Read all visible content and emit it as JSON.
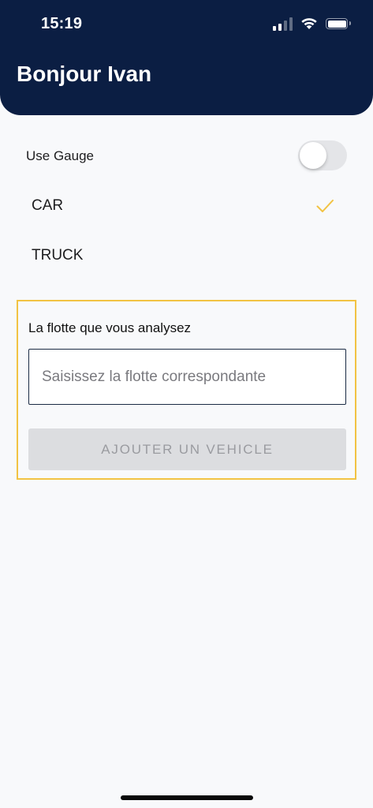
{
  "status_bar": {
    "time": "15:19",
    "icons": [
      "cellular-signal-icon",
      "wifi-icon",
      "battery-icon"
    ]
  },
  "header": {
    "title": "Bonjour Ivan",
    "background": "#0b1e43"
  },
  "settings": {
    "gauge_label": "Use Gauge",
    "gauge_enabled": false,
    "vehicle_types": [
      {
        "label": "CAR",
        "selected": true
      },
      {
        "label": "TRUCK",
        "selected": false
      }
    ],
    "check_color": "#f2c343"
  },
  "fleet": {
    "label": "La flotte que vous analysez",
    "input_value": "",
    "input_placeholder": "Saisissez la flotte correspondante",
    "add_button_label": "AJOUTER UN VEHICLE",
    "add_button_enabled": false,
    "border_color": "#f2c343"
  }
}
